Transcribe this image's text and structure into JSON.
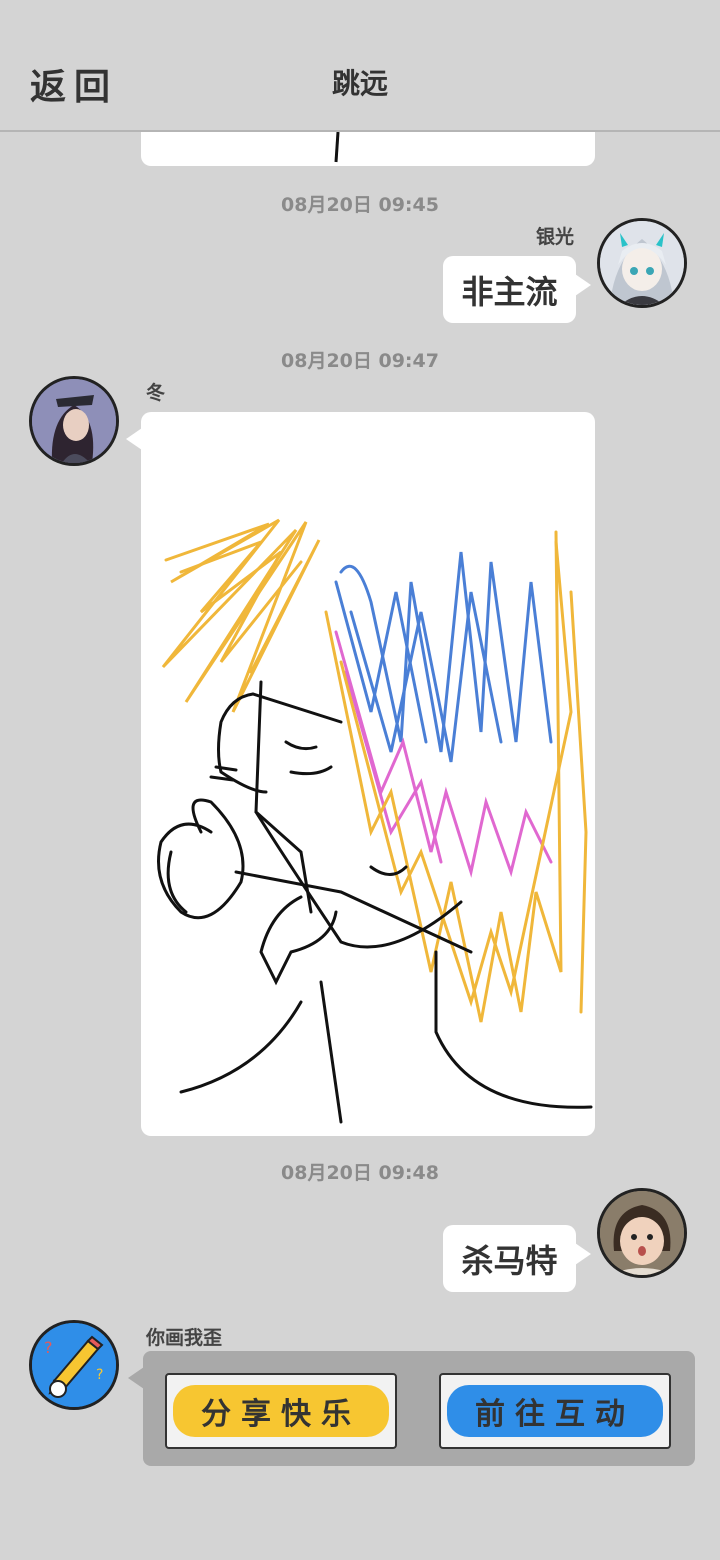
{
  "header": {
    "back_label": "返回",
    "title": "跳远"
  },
  "messages": [
    {
      "time": "08月20日  09:45",
      "sender": "银光",
      "text": "非主流"
    },
    {
      "time": "08月20日  09:47",
      "sender": "冬"
    },
    {
      "time": "08月20日  09:48",
      "text": "杀马特"
    }
  ],
  "app_card": {
    "sender": "你画我歪",
    "share_label": "分享快乐",
    "goto_label": "前往互动"
  },
  "colors": {
    "background": "#d4d4d4",
    "bubble": "#ffffff",
    "share_button": "#f7c631",
    "goto_button": "#2f8ee8"
  }
}
